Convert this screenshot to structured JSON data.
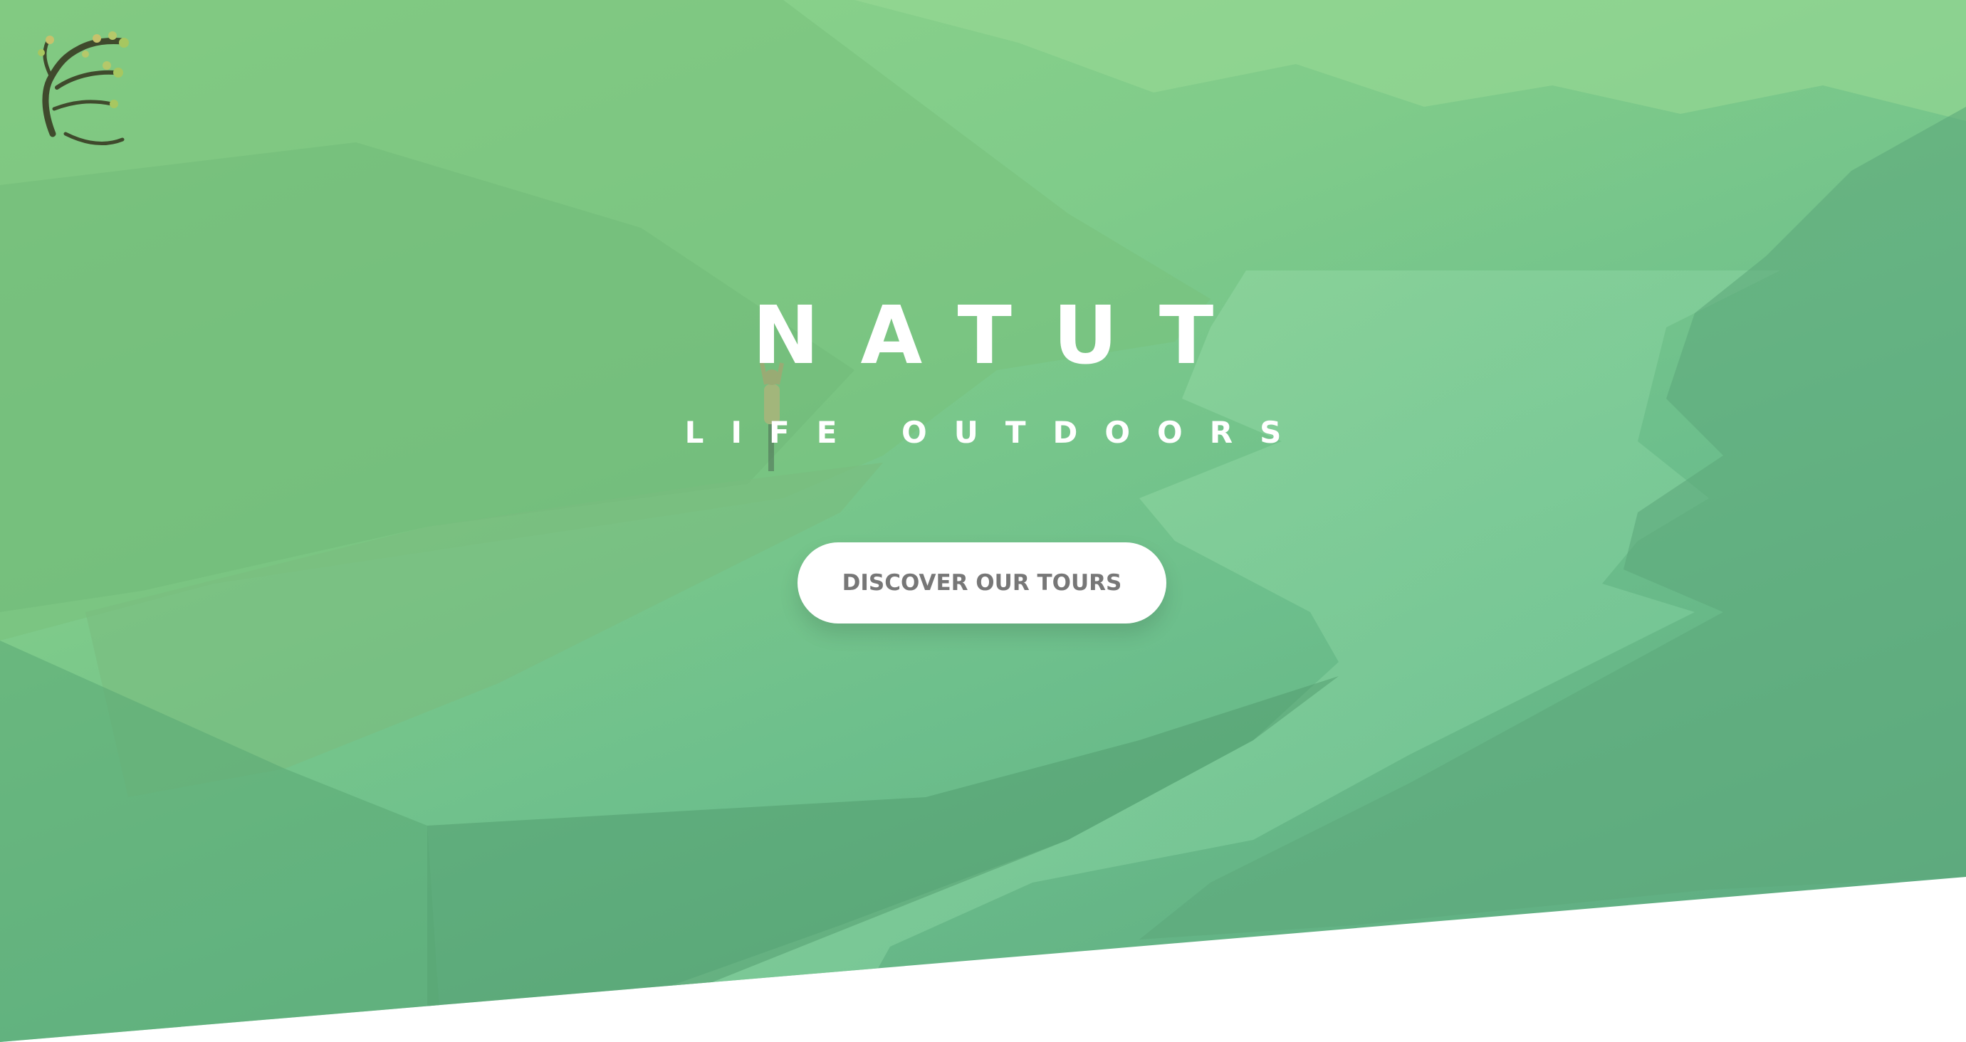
{
  "hero": {
    "title": "NATUT",
    "subtitle": "LIFE OUTDOORS",
    "cta_label": "DISCOVER OUR TOURS"
  },
  "logo": {
    "icon": "tree-logo-icon"
  },
  "colors": {
    "overlay_light": "#8fd48b",
    "overlay_dark": "#5aa77e",
    "cta_background": "#ffffff",
    "cta_text": "#777777",
    "heading_text": "#ffffff"
  }
}
